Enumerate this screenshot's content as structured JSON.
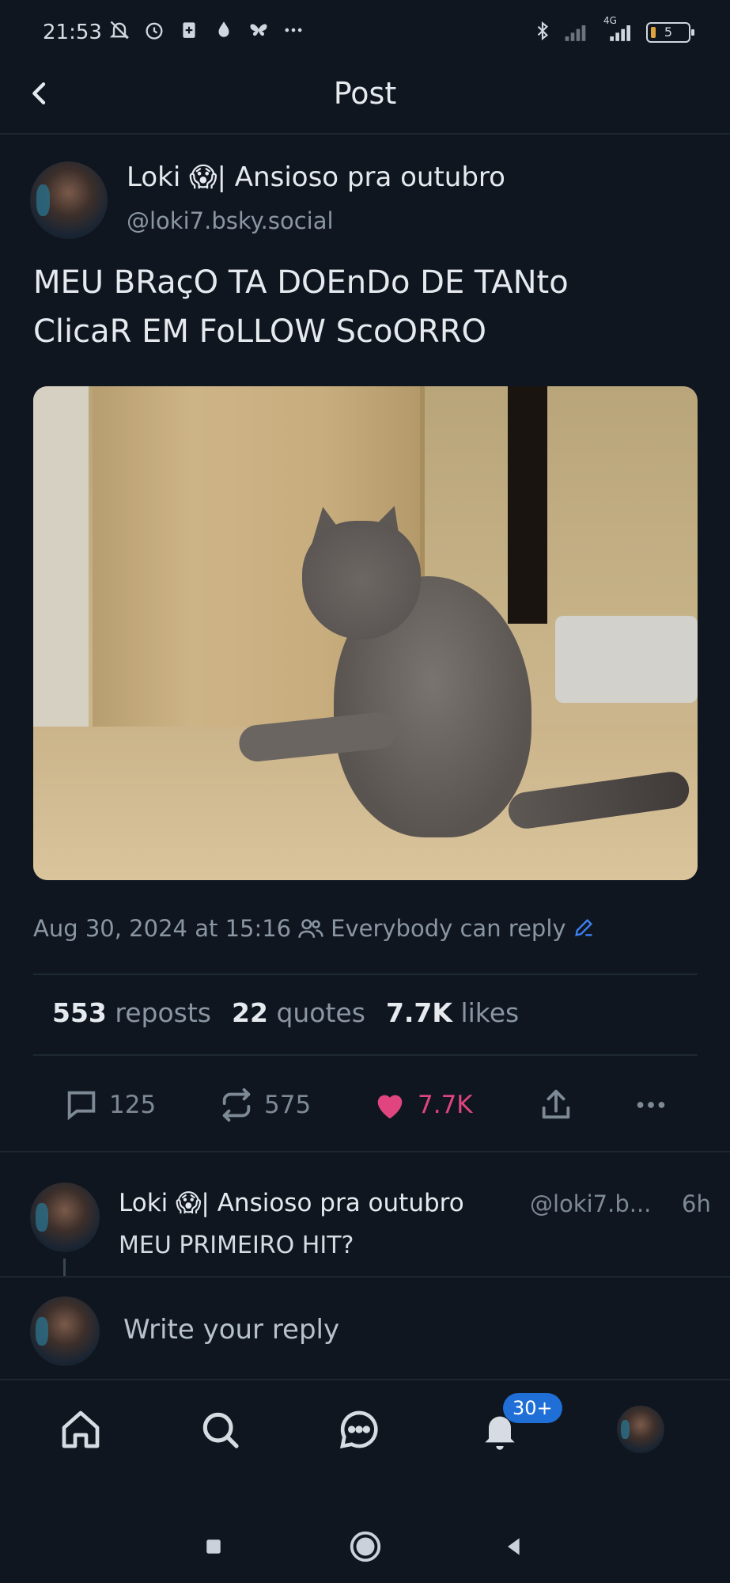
{
  "status_bar": {
    "time": "21:53",
    "network_label": "4G",
    "battery_level": "5"
  },
  "header": {
    "title": "Post"
  },
  "post": {
    "author_name": "Loki 😱| Ansioso pra outubro",
    "author_handle": "@loki7.bsky.social",
    "text_line1": "MEU BRaçO TA DOEnDo DE TANto",
    "text_line2": "ClicaR EM FoLLOW ScoORRO",
    "timestamp": "Aug 30, 2024 at 15:16",
    "reply_setting": "Everybody can reply",
    "stats": {
      "reposts_count": "553",
      "reposts_label": "reposts",
      "quotes_count": "22",
      "quotes_label": "quotes",
      "likes_count": "7.7K",
      "likes_label": "likes"
    },
    "actions": {
      "replies": "125",
      "reposts": "575",
      "likes": "7.7K"
    }
  },
  "reply": {
    "author_name": "Loki 😱| Ansioso pra outubro",
    "author_handle": "@loki7.b...",
    "time": "6h",
    "text": "MEU PRIMEIRO HIT?"
  },
  "compose": {
    "placeholder": "Write your reply"
  },
  "tab_bar": {
    "notifications_badge": "30+"
  },
  "colors": {
    "background": "#0f1620",
    "like": "#e0457f",
    "badge": "#1f6fd6",
    "edit_accent": "#3b82f6"
  }
}
